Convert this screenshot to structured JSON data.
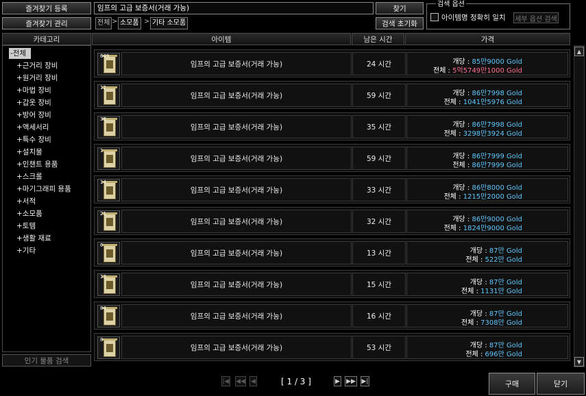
{
  "toolbar": {
    "favorites_register": "즐겨찾기 등록",
    "favorites_manage": "즐겨찾기 관리",
    "search_value": "임프의 고급 보증서(거래 가능)",
    "find_btn": "찾기",
    "reset_btn": "검색 초기화"
  },
  "breadcrumb": [
    "전체",
    "소모품",
    "기타 소모품"
  ],
  "options": {
    "title": "검색 옵션",
    "exact_match_label": "아이템명 정확히 일치",
    "detail_btn": "세부 옵션 검색"
  },
  "headers": {
    "category": "카테고리",
    "item": "아이템",
    "time": "남은 시간",
    "price": "가격"
  },
  "categories": {
    "all": "-전체",
    "items": [
      "+근거리 장비",
      "+원거리 장비",
      "+마법 장비",
      "+갑옷 장비",
      "+방어 장비",
      "+액세서리",
      "+특수 장비",
      "+설치물",
      "+인챈트 용품",
      "+스크롤",
      "+마기그래피 용품",
      "+서적",
      "+소모품",
      "+토템",
      "+생활 재료",
      "+기타"
    ]
  },
  "popular_btn": "인기 물품 검색",
  "labels": {
    "each": "개당 : ",
    "total": "전체 : "
  },
  "rows": [
    {
      "qty": "649",
      "name": "임프의 고급 보증서(거래 가능)",
      "time": "24 시간",
      "each": "85만9000 Gold",
      "total": "5억5749만1000 Gold",
      "total_red": true
    },
    {
      "qty": "12",
      "name": "임프의 고급 보증서(거래 가능)",
      "time": "59 시간",
      "each": "86만7998 Gold",
      "total": "1041만5976 Gold",
      "total_red": false
    },
    {
      "qty": "38",
      "name": "임프의 고급 보증서(거래 가능)",
      "time": "35 시간",
      "each": "86만7998 Gold",
      "total": "3298만3924 Gold",
      "total_red": false
    },
    {
      "qty": "1",
      "name": "임프의 고급 보증서(거래 가능)",
      "time": "59 시간",
      "each": "86만7999 Gold",
      "total": "86만7999 Gold",
      "total_red": false
    },
    {
      "qty": "14",
      "name": "임프의 고급 보증서(거래 가능)",
      "time": "33 시간",
      "each": "86만8000 Gold",
      "total": "1215만2000 Gold",
      "total_red": false
    },
    {
      "qty": "21",
      "name": "임프의 고급 보증서(거래 가능)",
      "time": "32 시간",
      "each": "86만9000 Gold",
      "total": "1824만9000 Gold",
      "total_red": false
    },
    {
      "qty": "6",
      "name": "임프의 고급 보증서(거래 가능)",
      "time": "13 시간",
      "each": "87만 Gold",
      "total": "522만 Gold",
      "total_red": false
    },
    {
      "qty": "13",
      "name": "임프의 고급 보증서(거래 가능)",
      "time": "15 시간",
      "each": "87만 Gold",
      "total": "1131만 Gold",
      "total_red": false
    },
    {
      "qty": "84",
      "name": "임프의 고급 보증서(거래 가능)",
      "time": "16 시간",
      "each": "87만 Gold",
      "total": "7308만 Gold",
      "total_red": false
    },
    {
      "qty": "8",
      "name": "임프의 고급 보증서(거래 가능)",
      "time": "53 시간",
      "each": "87만 Gold",
      "total": "696만 Gold",
      "total_red": false
    }
  ],
  "pagination": {
    "text": "[ 1 / 3 ]"
  },
  "actions": {
    "buy": "구매",
    "close": "닫기"
  }
}
